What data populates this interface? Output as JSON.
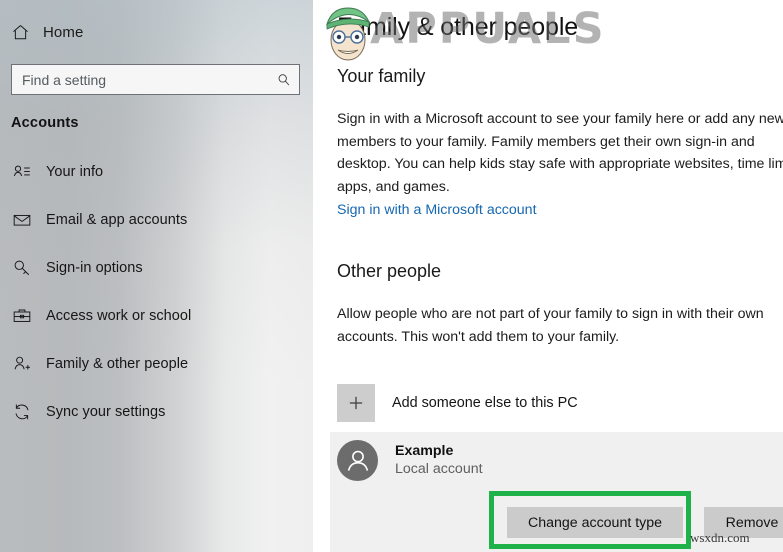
{
  "sidebar": {
    "home": {
      "label": "Home",
      "icon": "home-icon"
    },
    "search": {
      "value": "",
      "placeholder": "Find a setting",
      "icon": "search-icon"
    },
    "section_title": "Accounts",
    "items": [
      {
        "label": "Your info",
        "icon": "person-list-icon"
      },
      {
        "label": "Email & app accounts",
        "icon": "envelope-icon"
      },
      {
        "label": "Sign-in options",
        "icon": "key-icon"
      },
      {
        "label": "Access work or school",
        "icon": "briefcase-icon"
      },
      {
        "label": "Family & other people",
        "icon": "person-add-icon"
      },
      {
        "label": "Sync your settings",
        "icon": "sync-icon"
      }
    ]
  },
  "main": {
    "page_title": "Family & other people",
    "your_family": {
      "heading": "Your family",
      "description": "Sign in with a Microsoft account to see your family here or add any new members to your family. Family members get their own sign-in and desktop. You can help kids stay safe with appropriate websites, time limits, apps, and games.",
      "link": "Sign in with a Microsoft account"
    },
    "other_people": {
      "heading": "Other people",
      "description": "Allow people who are not part of your family to sign in with their own accounts. This won't add them to your family.",
      "add_someone_label": "Add someone else to this PC",
      "add_icon": "plus-icon",
      "account": {
        "name": "Example",
        "type": "Local account",
        "avatar_icon": "user-avatar-icon"
      },
      "buttons": {
        "change_account_type": "Change account type",
        "remove": "Remove"
      }
    }
  },
  "annotations": {
    "highlight_color": "#1fb24b",
    "highlight_target": "Change account type"
  },
  "watermarks": {
    "appuals": "APPUALS",
    "wsxdn": "wsxdn.com"
  }
}
